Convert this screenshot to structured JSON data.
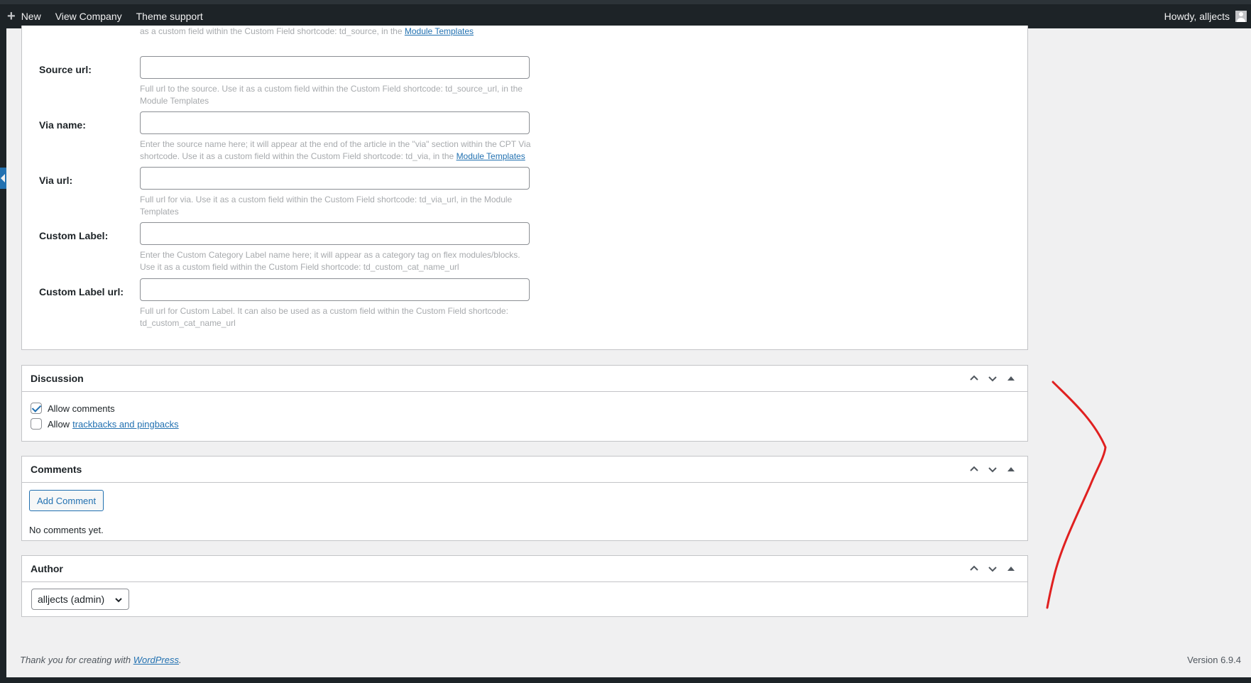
{
  "adminbar": {
    "new_label": "New",
    "view_company_label": "View Company",
    "theme_support_label": "Theme support",
    "howdy_label": "Howdy, alljects"
  },
  "meta_fields": {
    "top_desc_part": "as a custom field within the Custom Field shortcode: td_source, in the",
    "top_desc_link": "Module Templates",
    "source_url": {
      "label": "Source url:",
      "desc": "Full url to the source. Use it as a custom field within the Custom Field shortcode: td_source_url, in the Module Templates"
    },
    "via_name": {
      "label": "Via name:",
      "desc": "Enter the source name here; it will appear at the end of the article in the \"via\" section within the CPT Via shortcode. Use it as a custom field within the Custom Field shortcode: td_via, in the",
      "link": "Module Templates"
    },
    "via_url": {
      "label": "Via url:",
      "desc": "Full url for via. Use it as a custom field within the Custom Field shortcode: td_via_url, in the Module Templates"
    },
    "custom_label": {
      "label": "Custom Label:",
      "desc": "Enter the Custom Category Label name here; it will appear as a category tag on flex modules/blocks. Use it as a custom field within the Custom Field shortcode: td_custom_cat_name_url"
    },
    "custom_label_url": {
      "label": "Custom Label url:",
      "desc": "Full url for Custom Label. It can also be used as a custom field within the Custom Field shortcode: td_custom_cat_name_url"
    }
  },
  "discussion": {
    "title": "Discussion",
    "allow_comments": "Allow comments",
    "allow_prefix": "Allow",
    "trackbacks_link": "trackbacks and pingbacks"
  },
  "comments": {
    "title": "Comments",
    "add_comment": "Add Comment",
    "no_comments": "No comments yet."
  },
  "author": {
    "title": "Author",
    "selected": "alljects (admin)"
  },
  "footer": {
    "thanks_prefix": "Thank you for creating with",
    "wordpress_link": "WordPress",
    "thanks_suffix": ".",
    "version": "Version 6.9.4"
  },
  "colors": {
    "accent": "#2271b1",
    "adminbar": "#1d2327",
    "annotation": "#e02020"
  }
}
